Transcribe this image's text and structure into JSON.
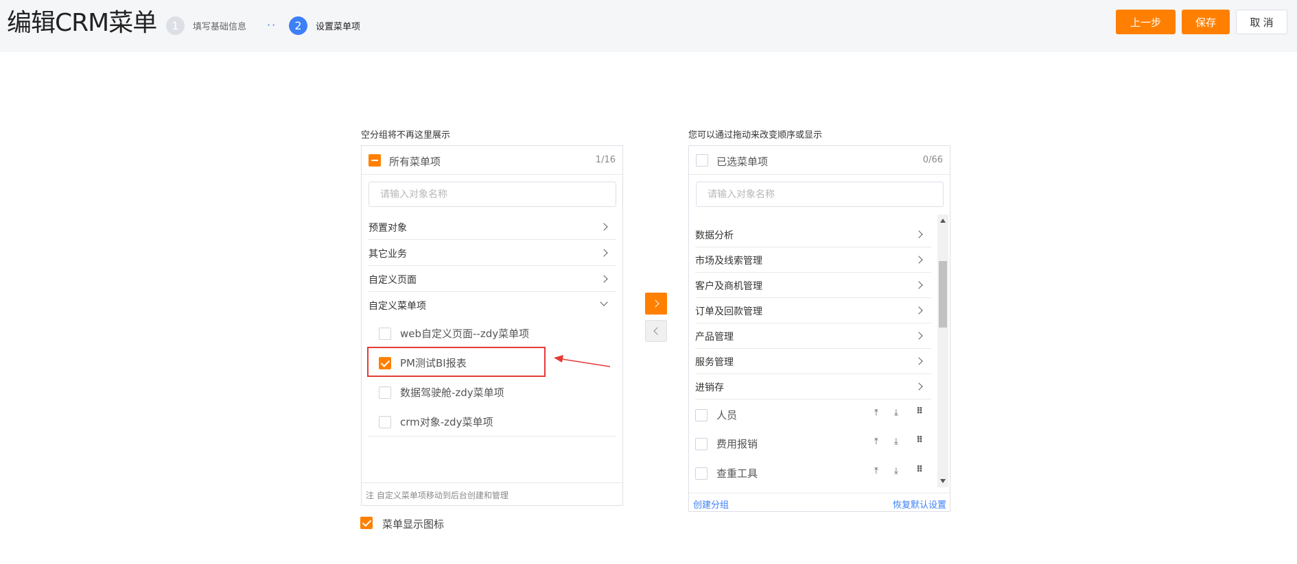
{
  "header": {
    "title": "编辑CRM菜单",
    "steps": [
      {
        "num": "1",
        "label": "填写基础信息"
      },
      {
        "num": "2",
        "label": "设置菜单项"
      }
    ],
    "step_separator": "··",
    "buttons": {
      "prev": "上一步",
      "save": "保存",
      "cancel": "取 消"
    }
  },
  "left_panel": {
    "caption": "空分组将不再这里展示",
    "head_label": "所有菜单项",
    "count": "1/16",
    "search_placeholder": "请输入对象名称",
    "groups": [
      "预置对象",
      "其它业务",
      "自定义页面",
      "自定义菜单项"
    ],
    "items": [
      "web自定义页面--zdy菜单项",
      "PM测试BI报表",
      "数据驾驶舱-zdy菜单项",
      "crm对象-zdy菜单项"
    ],
    "note": "注 自定义菜单项移动到后台创建和管理"
  },
  "right_panel": {
    "caption": "您可以通过拖动来改变顺序或显示",
    "head_label": "已选菜单项",
    "count": "0/66",
    "search_placeholder": "请输入对象名称",
    "groups": [
      "数据分析",
      "市场及线索管理",
      "客户及商机管理",
      "订单及回款管理",
      "产品管理",
      "服务管理",
      "进销存"
    ],
    "items": [
      "人员",
      "费用报销",
      "查重工具"
    ],
    "create_group": "创建分组",
    "restore_default": "恢复默认设置"
  },
  "show_icon_label": "菜单显示图标",
  "colors": {
    "accent": "#ff8000",
    "link": "#3d7ff6",
    "highlight": "#e53935"
  }
}
